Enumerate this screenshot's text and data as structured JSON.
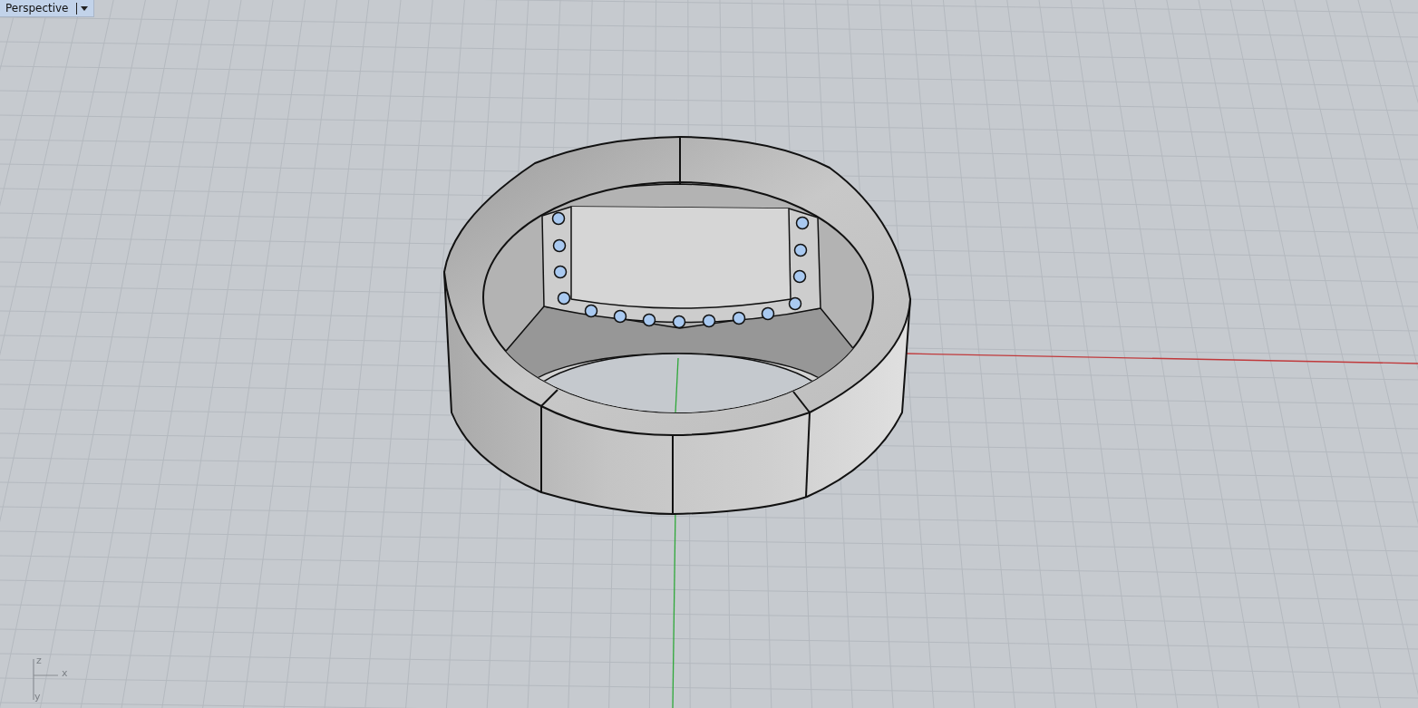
{
  "viewport": {
    "title": "Perspective"
  },
  "axis_gizmo": {
    "labels": [
      "z",
      "x",
      "y"
    ]
  }
}
